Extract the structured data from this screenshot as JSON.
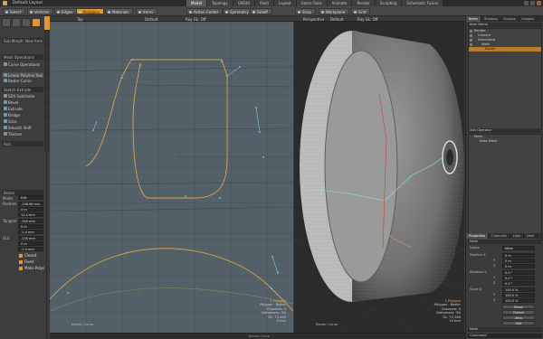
{
  "window": {
    "title": "Default Layout"
  },
  "layout_tabs": [
    "Model",
    "Topology",
    "UVEdit",
    "Paint",
    "Layout",
    "Game Tools",
    "Animate",
    "Render",
    "Sculpting",
    "Schematic Fusion"
  ],
  "toolbar": {
    "buttons": [
      "Select",
      "Vertices",
      "Edges",
      "Polygons",
      "Materials",
      "Items",
      "Action Center",
      "Symmetry",
      "Falloff",
      "Snap",
      "Workplane",
      "Grid"
    ],
    "active": "Polygons"
  },
  "left_panel": {
    "preset": "Sub Morph: New Item",
    "section_header": "Mesh Operations",
    "items": [
      "Curve Operations",
      "Linear Polyline Tool",
      "Bezier Curve",
      "Sketch Extrude",
      "SDS Subdivide",
      "Bevel",
      "Extrude",
      "Bridge",
      "Slice",
      "Smooth Shift",
      "Thicken"
    ],
    "selected": "Linear Polyline Tool",
    "mode_label": "Axis",
    "properties_header": "Bezier",
    "mode": "Edit",
    "fields": [
      {
        "label": "Position",
        "values": [
          "-136.96 mm",
          "0 m",
          "12.4 mm"
        ]
      },
      {
        "label": "Tangent",
        "values": [
          "-160 mm",
          "0 m",
          "-1.4 mm"
        ]
      },
      {
        "label": "Out",
        "values": [
          "-130 mm",
          "0 m",
          "-1.4 mm"
        ]
      }
    ],
    "checkboxes": [
      "Closed",
      "Fixed",
      "Make Polys"
    ]
  },
  "viewport_left": {
    "header": [
      "Top",
      "Default",
      "Ray GL: Off"
    ],
    "info": [
      "1 Polygon",
      "Polygon : Bezier",
      "Channels: 0",
      "Deformers: ON",
      "GL: 72,260",
      "5 mm"
    ],
    "corner": "Bezier Curve"
  },
  "viewport_right": {
    "header": [
      "Perspective",
      "Default",
      "Ray GL: Off"
    ],
    "info": [
      "1 Polygon",
      "Polygon : Bezier",
      "Channels: 0",
      "Deformers: ON",
      "GL: 72,260",
      "10 mm"
    ],
    "corner": "Bezier Curve"
  },
  "right_panel": {
    "top_tabs": [
      "Items",
      "Shading",
      "Groups",
      "Images"
    ],
    "items_title": "Item Name",
    "items": [
      "Render",
      "Camera",
      "Directional",
      "Mesh",
      "Bezier"
    ],
    "selected_item": "Bezier",
    "shader_title": "Add Operator",
    "shader_items": [
      "Mesh",
      "Base Mesh"
    ],
    "prop_tabs": [
      "Properties",
      "Channels",
      "Lists",
      "User"
    ],
    "prop_title": "Mesh",
    "props": [
      {
        "label": "Name",
        "value": "Mesh"
      },
      {
        "label": "Position X",
        "value": "0 m"
      },
      {
        "label": "Y",
        "value": "0 m"
      },
      {
        "label": "Z",
        "value": "0 m"
      },
      {
        "label": "Rotation X",
        "value": "0.0 °"
      },
      {
        "label": "Y",
        "value": "0.0 °"
      },
      {
        "label": "Z",
        "value": "0.0 °"
      },
      {
        "label": "Scale X",
        "value": "100.0 %"
      },
      {
        "label": "Y",
        "value": "100.0 %"
      },
      {
        "label": "Z",
        "value": "100.0 %"
      }
    ],
    "buttons": [
      "Reset",
      "Freeze",
      "Zero",
      "Add"
    ],
    "footer_label": "Mesh",
    "command_label": "Command"
  },
  "status": {
    "text": "Bezier Curve"
  },
  "colors": {
    "accent": "#e1962f",
    "viewport_left_bg": "#556169",
    "viewport_right_bg": "#2b2b2b",
    "curve": "#d8a24a",
    "handles": "#7fe6f0"
  }
}
